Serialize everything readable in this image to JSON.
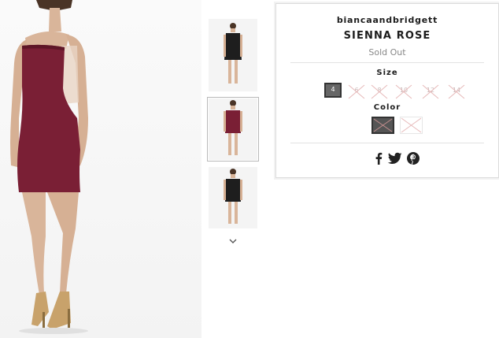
{
  "product": {
    "vendor": "biancaandbridgett",
    "title": "SIENNA ROSE",
    "status": "Sold Out",
    "size_label": "Size",
    "color_label": "Color",
    "sizes": [
      {
        "label": "4",
        "available": true,
        "selected": true
      },
      {
        "label": "6",
        "available": false,
        "selected": false
      },
      {
        "label": "8",
        "available": false,
        "selected": false
      },
      {
        "label": "10",
        "available": false,
        "selected": false
      },
      {
        "label": "12",
        "available": false,
        "selected": false
      },
      {
        "label": "14",
        "available": false,
        "selected": false
      }
    ],
    "colors": [
      {
        "name": "black",
        "hex": "#2a2a2a",
        "selected": true
      },
      {
        "name": "burgundy",
        "hex": "#ffffff",
        "selected": false
      }
    ],
    "share_icons": [
      "facebook-icon",
      "twitter-icon",
      "pinterest-icon"
    ]
  },
  "gallery": {
    "dress_color": "#7a1f35",
    "thumb_dress_colors": [
      "#1e1e1e",
      "#7a1f35",
      "#1e1e1e"
    ],
    "selected_thumb": 2
  },
  "colors": {
    "text": "#1c1c1c",
    "muted": "#888888",
    "border": "#dcdcdc",
    "strike": "#e7b9b9"
  }
}
